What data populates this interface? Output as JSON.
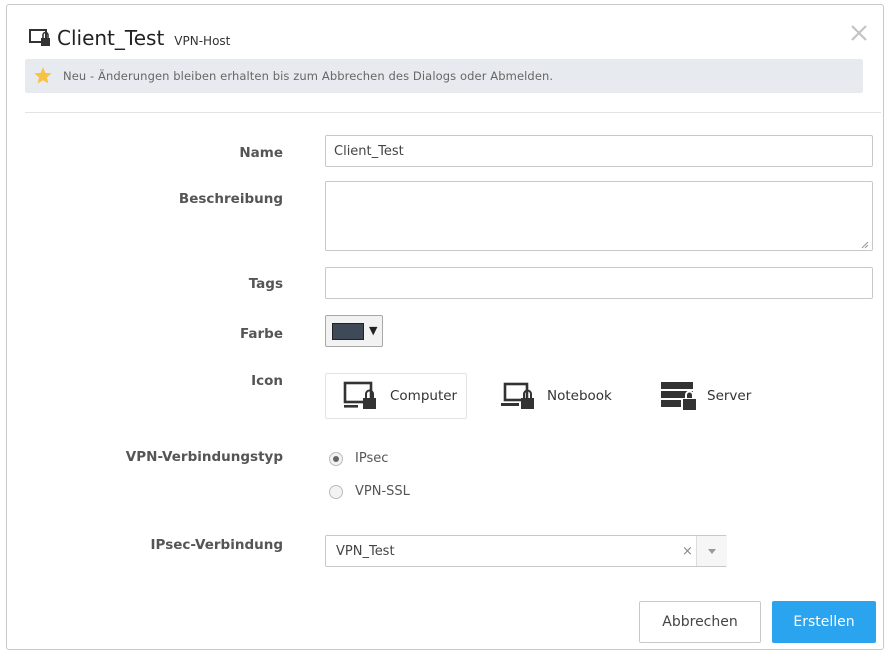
{
  "dialog": {
    "title": "Client_Test",
    "subtitle": "VPN-Host",
    "banner_text": "Neu - Änderungen bleiben erhalten bis zum Abbrechen des Dialogs oder Abmelden."
  },
  "form": {
    "name_label": "Name",
    "name_value": "Client_Test",
    "description_label": "Beschreibung",
    "description_value": "",
    "tags_label": "Tags",
    "tags_value": "",
    "color_label": "Farbe",
    "color_value": "#3e4a57",
    "icon_label": "Icon",
    "icon_options": [
      {
        "label": "Computer",
        "icon": "computer-lock-icon",
        "selected": true
      },
      {
        "label": "Notebook",
        "icon": "notebook-lock-icon",
        "selected": false
      },
      {
        "label": "Server",
        "icon": "server-lock-icon",
        "selected": false
      }
    ],
    "vpn_type_label": "VPN-Verbindungstyp",
    "vpn_type_options": [
      {
        "label": "IPsec",
        "selected": true
      },
      {
        "label": "VPN-SSL",
        "selected": false
      }
    ],
    "ipsec_label": "IPsec-Verbindung",
    "ipsec_value": "VPN_Test",
    "ipsec_clear": "×"
  },
  "buttons": {
    "cancel": "Abbrechen",
    "create": "Erstellen"
  },
  "colors": {
    "primary": "#2aa4ee",
    "banner_bg": "#e7ebf0",
    "star": "#f6c342"
  }
}
